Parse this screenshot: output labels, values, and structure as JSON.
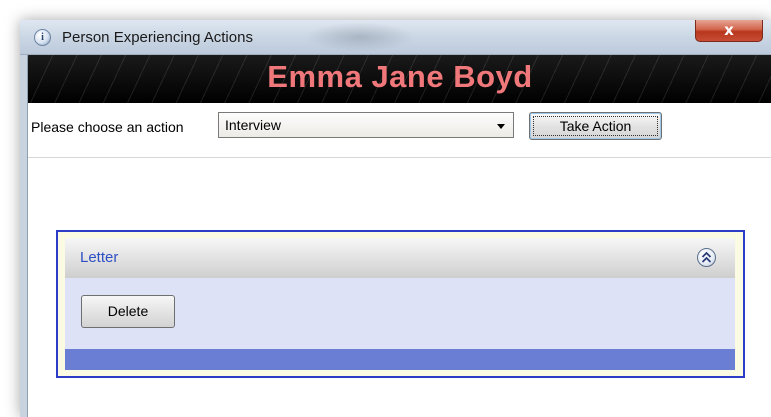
{
  "window": {
    "title": "Person Experiencing Actions",
    "icon": "info-app-icon",
    "icon_glyph": "i",
    "close_glyph": "x"
  },
  "banner": {
    "person_name": "Emma Jane Boyd",
    "name_color": "#f0787a"
  },
  "action_bar": {
    "label": "Please choose an action",
    "selected_action": "Interview",
    "take_action_label": "Take Action"
  },
  "panel": {
    "title": "Letter",
    "collapse_icon": "double-chevron-up-icon",
    "delete_label": "Delete",
    "border_color": "#2d3cc8",
    "footer_color": "#6a7fd4"
  }
}
